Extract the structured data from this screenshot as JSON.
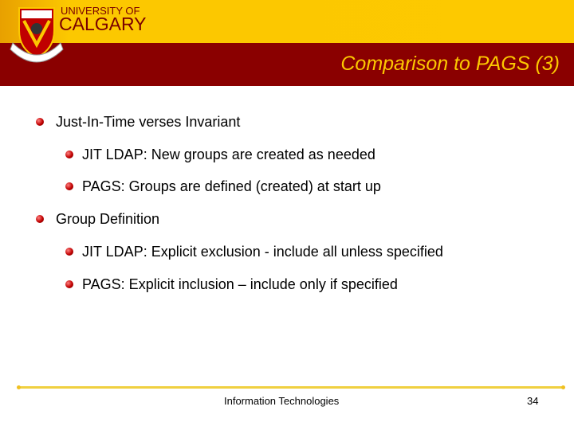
{
  "header": {
    "logo_line1": "UNIVERSITY OF",
    "logo_line2": "CALGARY",
    "title": "Comparison to PAGS (3)"
  },
  "bullets": [
    {
      "text": "Just-In-Time verses Invariant",
      "children": [
        "JIT LDAP: New groups are created as needed",
        "PAGS: Groups are defined (created) at start up"
      ]
    },
    {
      "text": "Group Definition",
      "children": [
        "JIT LDAP: Explicit exclusion - include all unless specified",
        "PAGS: Explicit inclusion – include only if specified"
      ]
    }
  ],
  "footer": {
    "center": "Information Technologies",
    "page": "34"
  },
  "colors": {
    "gold": "#fdc900",
    "maroon": "#8a0000",
    "title": "#fcc800"
  }
}
